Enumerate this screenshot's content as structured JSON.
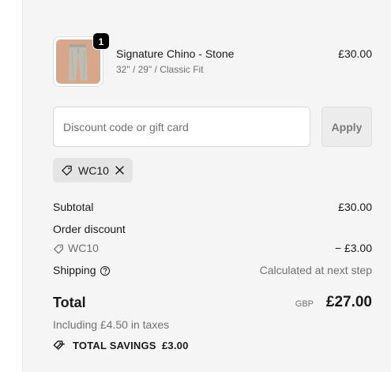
{
  "product": {
    "name": "Signature Chino - Stone",
    "variant": "32\" / 29\" / Classic Fit",
    "price": "£30.00",
    "quantity": "1",
    "thumbnail_icon": "chino-trousers-thumbnail"
  },
  "discount": {
    "placeholder": "Discount code or gift card",
    "value": "",
    "apply_label": "Apply",
    "applied_code": "WC10"
  },
  "summary": {
    "subtotal_label": "Subtotal",
    "subtotal_value": "£30.00",
    "order_discount_label": "Order discount",
    "discount_code": "WC10",
    "discount_value": "− £3.00",
    "shipping_label": "Shipping",
    "shipping_value": "Calculated at next step",
    "total_label": "Total",
    "currency": "GBP",
    "total_value": "£27.00",
    "taxes_note": "Including £4.50 in taxes",
    "savings_label": "TOTAL SAVINGS",
    "savings_value": "£3.00"
  },
  "colors": {
    "panel_bg": "#f5f5f5",
    "thumb_bg": "#d7a78c",
    "text": "#1a1a1a",
    "muted": "#707070"
  }
}
